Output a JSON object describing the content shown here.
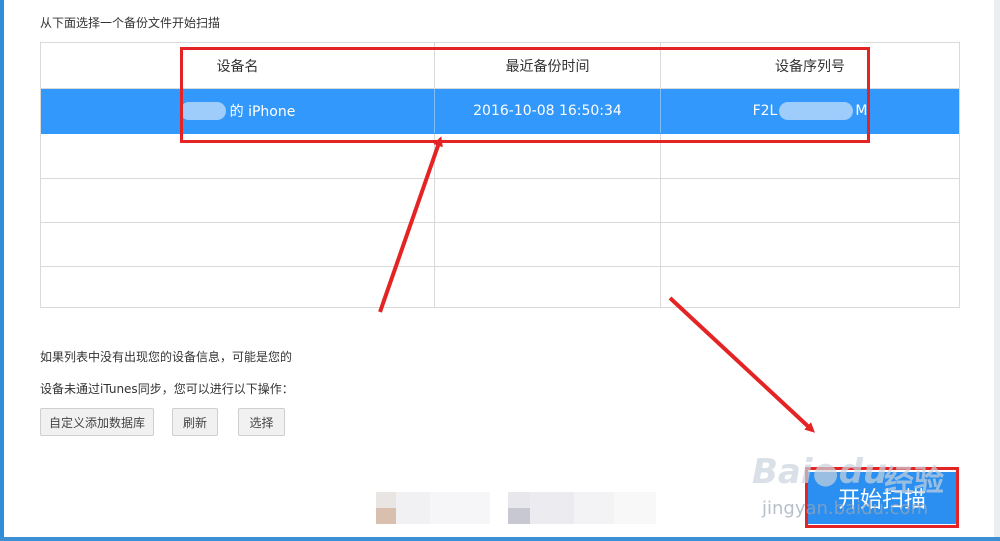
{
  "instruction": "从下面选择一个备份文件开始扫描",
  "table": {
    "headers": [
      "设备名",
      "最近备份时间",
      "设备序列号"
    ],
    "rows": [
      {
        "device_name": "的 iPhone",
        "backup_time": "2016-10-08 16:50:34",
        "serial_prefix": "F2L",
        "serial_suffix": "M"
      }
    ]
  },
  "hints": {
    "line1": "如果列表中没有出现您的设备信息，可能是您的",
    "line2": "设备未通过iTunes同步，您可以进行以下操作："
  },
  "buttons": {
    "custom_add": "自定义添加数据库",
    "refresh": "刷新",
    "select": "选择"
  },
  "start_scan": "开始扫描",
  "watermark": {
    "brand": "Bai",
    "brand2": "du",
    "product": "经验",
    "url": "jingyan.baidu.com"
  },
  "colors": {
    "selected_row": "#3398fb",
    "scan_button": "#2a8ff0",
    "annotation_red": "#e42424"
  }
}
